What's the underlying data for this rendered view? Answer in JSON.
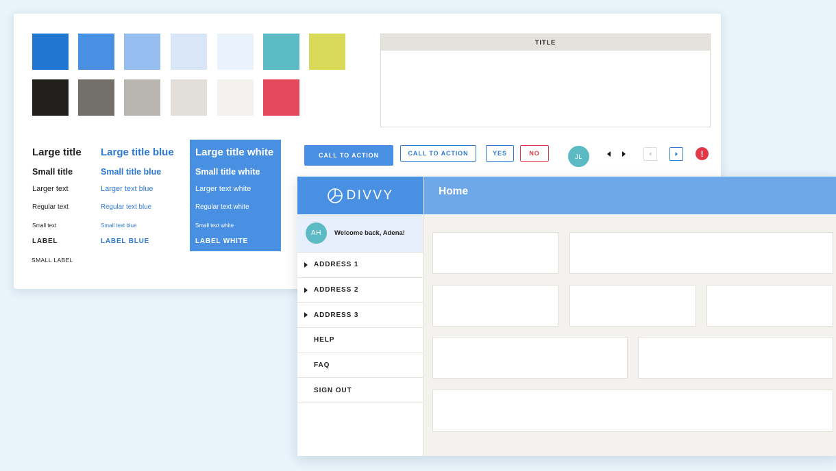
{
  "colors": {
    "blue_dark": "#2176d2",
    "blue": "#4a90e2",
    "blue_light": "#95bdef",
    "blue_lighter": "#d9e6f8",
    "blue_lightest": "#eaf2fc",
    "teal": "#5bbac4",
    "lime": "#d9da59",
    "black": "#22201d",
    "gray_dark": "#736f69",
    "gray": "#b9b6b1",
    "gray_light": "#e2dfdb",
    "gray_lighter": "#f3f2ee",
    "red": "#e7495c"
  },
  "typography": {
    "default": {
      "large_title": "Large title",
      "small_title": "Small title",
      "larger_text": "Larger text",
      "regular_text": "Regular text",
      "small_text": "Small text",
      "label": "LABEL",
      "small_label": "SMALL LABEL"
    },
    "blue": {
      "large_title": "Large title blue",
      "small_title": "Small title blue",
      "larger_text": "Larger text blue",
      "regular_text": "Regular text blue",
      "small_text": "Small text blue",
      "label": "LABEL BLUE"
    },
    "white": {
      "large_title": "Large title white",
      "small_title": "Small title white",
      "larger_text": "Larger text white",
      "regular_text": "Regular text white",
      "small_text": "Small text white",
      "label": "LABEL WHITE"
    }
  },
  "table": {
    "title": "TITLE"
  },
  "buttons": {
    "primary": "CALL TO ACTION",
    "secondary": "CALL TO ACTION",
    "yes": "YES",
    "no": "NO"
  },
  "avatar_initials": "JL",
  "alert_symbol": "!",
  "app": {
    "logo_text": "DIVVY",
    "page_title": "Home",
    "welcome_initials": "AH",
    "welcome_text": "Welcome back, Adena!",
    "nav": [
      {
        "label": "ADDRESS 1",
        "expandable": true
      },
      {
        "label": "ADDRESS 2",
        "expandable": true
      },
      {
        "label": "ADDRESS 3",
        "expandable": true
      },
      {
        "label": "HELP",
        "expandable": false
      },
      {
        "label": "FAQ",
        "expandable": false
      },
      {
        "label": "SIGN OUT",
        "expandable": false
      }
    ]
  }
}
